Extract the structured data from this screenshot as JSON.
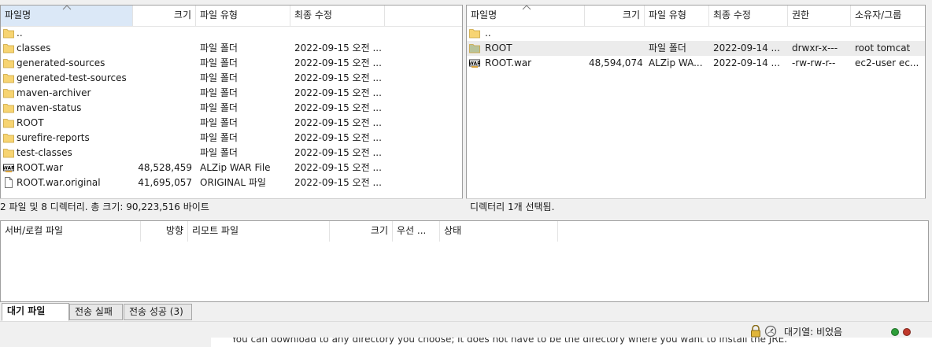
{
  "local": {
    "columns": [
      "파일명",
      "크기",
      "파일 유형",
      "최종 수정"
    ],
    "rows": [
      {
        "name": "..",
        "size": "",
        "type": "",
        "modified": "",
        "icon": "folder-icon"
      },
      {
        "name": "classes",
        "size": "",
        "type": "파일 폴더",
        "modified": "2022-09-15 오전 ...",
        "icon": "folder-icon"
      },
      {
        "name": "generated-sources",
        "size": "",
        "type": "파일 폴더",
        "modified": "2022-09-15 오전 ...",
        "icon": "folder-icon"
      },
      {
        "name": "generated-test-sources",
        "size": "",
        "type": "파일 폴더",
        "modified": "2022-09-15 오전 ...",
        "icon": "folder-icon"
      },
      {
        "name": "maven-archiver",
        "size": "",
        "type": "파일 폴더",
        "modified": "2022-09-15 오전 ...",
        "icon": "folder-icon"
      },
      {
        "name": "maven-status",
        "size": "",
        "type": "파일 폴더",
        "modified": "2022-09-15 오전 ...",
        "icon": "folder-icon"
      },
      {
        "name": "ROOT",
        "size": "",
        "type": "파일 폴더",
        "modified": "2022-09-15 오전 ...",
        "icon": "folder-icon"
      },
      {
        "name": "surefire-reports",
        "size": "",
        "type": "파일 폴더",
        "modified": "2022-09-15 오전 ...",
        "icon": "folder-icon"
      },
      {
        "name": "test-classes",
        "size": "",
        "type": "파일 폴더",
        "modified": "2022-09-15 오전 ...",
        "icon": "folder-icon"
      },
      {
        "name": "ROOT.war",
        "size": "48,528,459",
        "type": "ALZip WAR File",
        "modified": "2022-09-15 오전 ...",
        "icon": "war-file-icon"
      },
      {
        "name": "ROOT.war.original",
        "size": "41,695,057",
        "type": "ORIGINAL 파일",
        "modified": "2022-09-15 오전 ...",
        "icon": "file-icon"
      }
    ],
    "status": "2 파일 및 8 디렉터리. 총 크기: 90,223,516 바이트"
  },
  "remote": {
    "columns": [
      "파일명",
      "크기",
      "파일 유형",
      "최종 수정",
      "권한",
      "소유자/그룹"
    ],
    "rows": [
      {
        "name": "..",
        "size": "",
        "type": "",
        "modified": "",
        "perms": "",
        "owner": "",
        "icon": "folder-icon"
      },
      {
        "name": "ROOT",
        "size": "",
        "type": "파일 폴더",
        "modified": "2022-09-14 ...",
        "perms": "drwxr-x---",
        "owner": "root tomcat",
        "icon": "folder-icon"
      },
      {
        "name": "ROOT.war",
        "size": "48,594,074",
        "type": "ALZip WA...",
        "modified": "2022-09-14 ...",
        "perms": "-rw-rw-r--",
        "owner": "ec2-user ec...",
        "icon": "war-file-icon"
      }
    ],
    "status": "디렉터리 1개 선택됨."
  },
  "queue": {
    "columns": [
      "서버/로컬 파일",
      "방향",
      "리모트 파일",
      "크기",
      "우선 ...",
      "상태"
    ]
  },
  "tabs": [
    "대기 파일",
    "전송 실패",
    "전송 성공 (3)"
  ],
  "statusbar": {
    "queue_label": "대기열: 비었음"
  },
  "leaked_text": "You can download to any directory you choose; it does not have to be the directory where you want to install the JRE.",
  "colors": {
    "folder": "#f7d472",
    "selected_folder": "#b8c39a",
    "sort_header": "#dbe8f7",
    "led_green": "#2e9e3a",
    "led_red": "#c0392b"
  }
}
